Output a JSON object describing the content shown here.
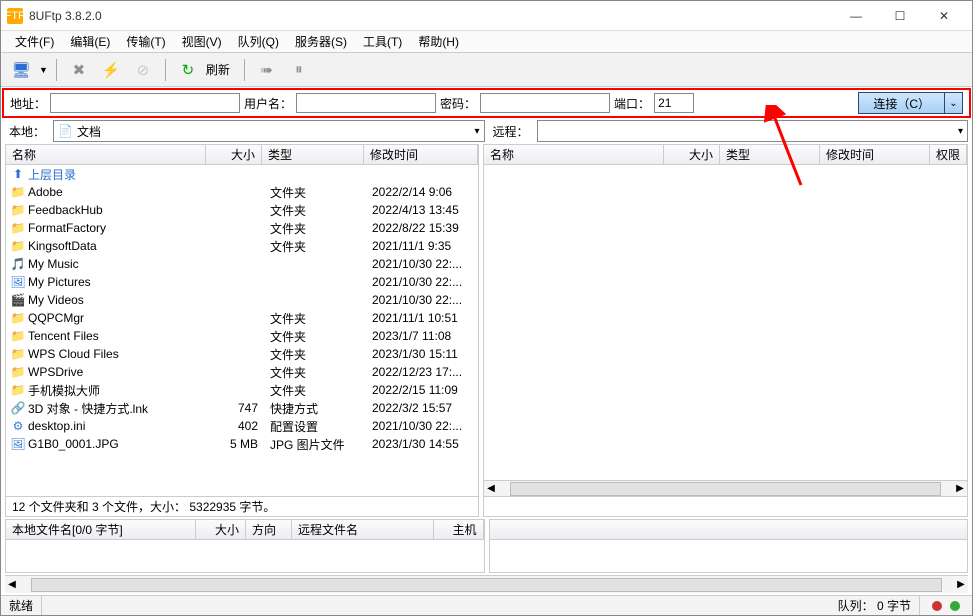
{
  "title": "8UFtp 3.8.2.0",
  "menu": [
    "文件(F)",
    "编辑(E)",
    "传输(T)",
    "视图(V)",
    "队列(Q)",
    "服务器(S)",
    "工具(T)",
    "帮助(H)"
  ],
  "toolbar": {
    "refresh": "刷新"
  },
  "connect": {
    "addr_lbl": "地址：",
    "user_lbl": "用户名：",
    "pass_lbl": "密码：",
    "port_lbl": "端口：",
    "port_val": "21",
    "connect_btn": "连接（C）"
  },
  "sites": {
    "local_lbl": "本地：",
    "local_sel": "文档",
    "remote_lbl": "远程：",
    "remote_sel": ""
  },
  "local_cols": {
    "name": "名称",
    "size": "大小",
    "type": "类型",
    "mod": "修改时间"
  },
  "remote_cols": {
    "name": "名称",
    "size": "大小",
    "type": "类型",
    "mod": "修改时间",
    "perm": "权限"
  },
  "queue_cols_l": {
    "fn": "本地文件名[0/0 字节]",
    "size": "大小",
    "dir": "方向",
    "rfn": "远程文件名",
    "host": "主机"
  },
  "local_files": [
    {
      "icon": "up",
      "name": "上层目录",
      "size": "",
      "type": "",
      "mod": "",
      "color": "#2a6fd1"
    },
    {
      "icon": "folder",
      "name": "Adobe",
      "size": "",
      "type": "文件夹",
      "mod": "2022/2/14 9:06"
    },
    {
      "icon": "folder",
      "name": "FeedbackHub",
      "size": "",
      "type": "文件夹",
      "mod": "2022/4/13 13:45"
    },
    {
      "icon": "folder",
      "name": "FormatFactory",
      "size": "",
      "type": "文件夹",
      "mod": "2022/8/22 15:39"
    },
    {
      "icon": "folder",
      "name": "KingsoftData",
      "size": "",
      "type": "文件夹",
      "mod": "2021/11/1 9:35"
    },
    {
      "icon": "music",
      "name": "My Music",
      "size": "",
      "type": "",
      "mod": "2021/10/30 22:..."
    },
    {
      "icon": "pic",
      "name": "My Pictures",
      "size": "",
      "type": "",
      "mod": "2021/10/30 22:..."
    },
    {
      "icon": "vid",
      "name": "My Videos",
      "size": "",
      "type": "",
      "mod": "2021/10/30 22:..."
    },
    {
      "icon": "folder",
      "name": "QQPCMgr",
      "size": "",
      "type": "文件夹",
      "mod": "2021/11/1 10:51"
    },
    {
      "icon": "folder",
      "name": "Tencent Files",
      "size": "",
      "type": "文件夹",
      "mod": "2023/1/7 11:08"
    },
    {
      "icon": "folder",
      "name": "WPS Cloud Files",
      "size": "",
      "type": "文件夹",
      "mod": "2023/1/30 15:11"
    },
    {
      "icon": "folder",
      "name": "WPSDrive",
      "size": "",
      "type": "文件夹",
      "mod": "2022/12/23 17:..."
    },
    {
      "icon": "folder",
      "name": "手机模拟大师",
      "size": "",
      "type": "文件夹",
      "mod": "2022/2/15 11:09"
    },
    {
      "icon": "lnk",
      "name": "3D 对象 - 快捷方式.lnk",
      "size": "747",
      "type": "快捷方式",
      "mod": "2022/3/2 15:57"
    },
    {
      "icon": "ini",
      "name": "desktop.ini",
      "size": "402",
      "type": "配置设置",
      "mod": "2021/10/30 22:..."
    },
    {
      "icon": "jpg",
      "name": "G1B0_0001.JPG",
      "size": "5 MB",
      "type": "JPG 图片文件",
      "mod": "2023/1/30 14:55"
    }
  ],
  "summary": "12 个文件夹和 3 个文件，大小： 5322935 字节。",
  "status": {
    "ready": "就绪",
    "queue": "队列： 0 字节"
  }
}
